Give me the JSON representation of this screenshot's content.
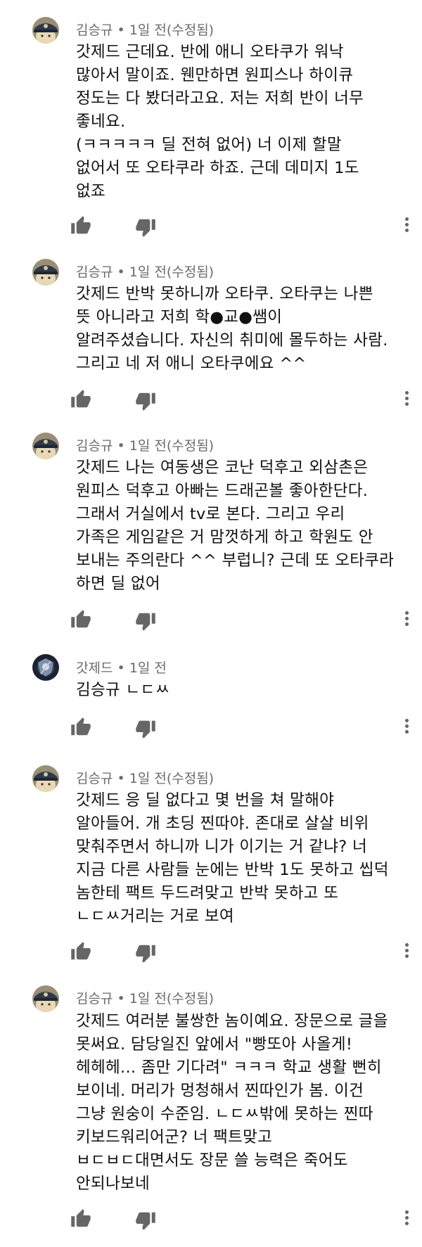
{
  "comments": [
    {
      "author": "김승규",
      "meta": " • 1일 전(수정됨)",
      "avatar": "hat-avatar",
      "text": "갓제드 근데요. 반에 애니 오타쿠가 워낙\n많아서 말이죠. 웬만하면 원피스나 하이큐\n정도는 다 봤더라고요. 저는 저희 반이 너무\n좋네요.\n(ㅋㅋㅋㅋㅋ 딜 전혀 없어) 너 이제 할말\n없어서 또 오타쿠라 하죠. 근데 데미지 1도\n없죠"
    },
    {
      "author": "김승규",
      "meta": " • 1일 전(수정됨)",
      "avatar": "hat-avatar",
      "text": "갓제드 반박 못하니까 오타쿠. 오타쿠는 나쁜\n뜻 아니라고 저희 학●교●쌤이\n알려주셨습니다. 자신의 취미에 몰두하는 사람.\n그리고 네 저 애니 오타쿠에요 ^^"
    },
    {
      "author": "김승규",
      "meta": " • 1일 전(수정됨)",
      "avatar": "hat-avatar",
      "text": "갓제드 나는 여동생은 코난 덕후고 외삼촌은\n원피스 덕후고 아빠는 드래곤볼 좋아한단다.\n그래서 거실에서 tv로 본다. 그리고 우리\n가족은 게임같은 거 맘껏하게 하고 학원도 안\n보내는 주의란다 ^^ 부럽니? 근데 또 오타쿠라\n하면 딜 없어"
    },
    {
      "author": "갓제드",
      "meta": " • 1일 전",
      "avatar": "dark-avatar",
      "text": "김승규 ㄴㄷㅆ"
    },
    {
      "author": "김승규",
      "meta": " • 1일 전(수정됨)",
      "avatar": "hat-avatar",
      "text": "갓제드 응 딜 없다고 몇 번을 쳐 말해야\n알아들어. 개 초딩 찐따야. 존대로 살살 비위\n맞춰주면서 하니까 니가 이기는 거 같냐? 너\n지금 다른 사람들 눈에는 반박 1도 못하고 씹덕\n놈한테 팩트 두드려맞고 반박 못하고 또\nㄴㄷㅆ거리는 거로 보여"
    },
    {
      "author": "김승규",
      "meta": " • 1일 전(수정됨)",
      "avatar": "hat-avatar",
      "text": "갓제드 여러분 불쌍한 놈이예요. 장문으로 글을\n못써요. 담당일진 앞에서 \"빵또아 사올게!\n헤헤헤... 좀만 기다려\" ㅋㅋㅋ 학교 생활 뻔히\n보이네. 머리가 멍청해서 찐따인가 봄. 이건\n그냥 원숭이 수준임. ㄴㄷㅆ밖에 못하는 찐따\n키보드워리어군? 너 팩트맞고\nㅂㄷㅂㄷ대면서도 장문 쓸 능력은 죽어도\n안되나보네"
    }
  ]
}
